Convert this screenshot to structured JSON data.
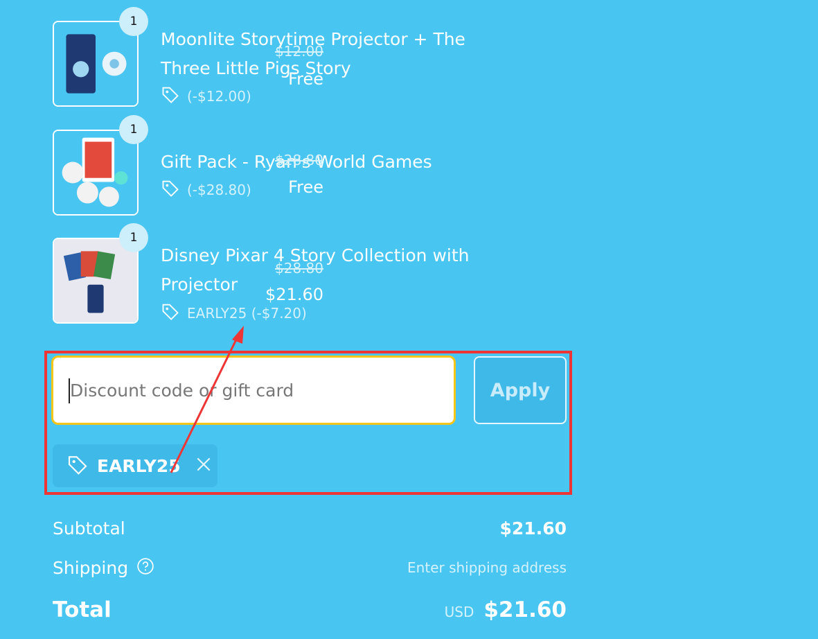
{
  "items": [
    {
      "qty": "1",
      "title": "Moonlite Storytime Projector + The Three Little Pigs Story",
      "discount": "(-$12.00)",
      "original_price": "$12.00",
      "price": "Free"
    },
    {
      "qty": "1",
      "title": "Gift Pack - Ryan's World Games",
      "discount": "(-$28.80)",
      "original_price": "$28.80",
      "price": "Free"
    },
    {
      "qty": "1",
      "title": "Disney Pixar 4 Story Collection with Projector",
      "discount": "EARLY25 (-$7.20)",
      "original_price": "$28.80",
      "price": "$21.60"
    }
  ],
  "discount_form": {
    "placeholder": "Discount code or gift card",
    "apply_label": "Apply",
    "applied_code": "EARLY25"
  },
  "summary": {
    "subtotal_label": "Subtotal",
    "subtotal_value": "$21.60",
    "shipping_label": "Shipping",
    "shipping_value": "Enter shipping address",
    "total_label": "Total",
    "currency": "USD",
    "total_value": "$21.60"
  },
  "colors": {
    "background": "#48c5f1",
    "highlight": "#ee3535",
    "input_border": "#f5c518"
  }
}
